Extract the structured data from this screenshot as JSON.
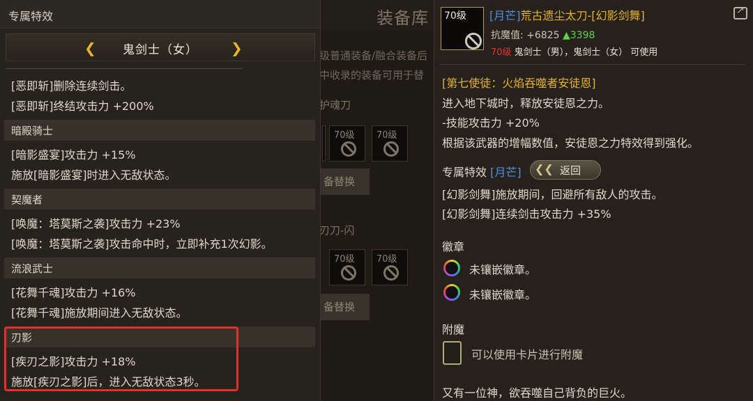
{
  "background": {
    "title": "装备库",
    "notice_lines": [
      "级普通装备/融合装备后",
      "中收录的装备可用于替"
    ],
    "section1_label": "护魂刀",
    "section2_label": "刃刀-闪",
    "slot_level": "70级",
    "swap_button": "备替换"
  },
  "left": {
    "title": "专属特效",
    "class_name": "鬼剑士（女）",
    "prev_arrow": "❮",
    "next_arrow": "❯",
    "intro_lines": [
      "[恶即斩]删除连续剑击。",
      "[恶即斩]终结攻击力 +200%"
    ],
    "sections": [
      {
        "name": "暗殿骑士",
        "lines": [
          "[暗影盛宴]攻击力 +15%",
          "施放[暗影盛宴]时进入无敌状态。"
        ]
      },
      {
        "name": "契魔者",
        "lines": [
          "[唤魔：塔莫斯之袭]攻击力 +23%",
          "[唤魔：塔莫斯之袭]攻击命中时，立即补充1次幻影。"
        ]
      },
      {
        "name": "流浪武士",
        "lines": [
          "[花舞千魂]攻击力 +16%",
          "[花舞千魂]施放期间进入无敌状态。"
        ]
      },
      {
        "name": "刃影",
        "lines": [
          "[疾刃之影]攻击力 +18%",
          "施放[疾刃之影]后，进入无敌状态3秒。"
        ]
      }
    ]
  },
  "right": {
    "item": {
      "level_badge": "70级",
      "rarity": "[月芒]",
      "name": "荒古遗尘太刀-[幻影剑舞]",
      "stat_label": "抗魔值: +6825",
      "stat_increase": "▲3398",
      "req_level": "70级",
      "req_classes": " 鬼剑士（男），鬼剑士（女） 可使用"
    },
    "apostle_title": "[第七使徒：火焰吞噬者安徒恩]",
    "apostle_lines": [
      "进入地下城时，释放安徒恩之力。",
      "-技能攻击力 +20%",
      "根据该武器的增幅数值，安徒恩之力特效得到强化。"
    ],
    "special": {
      "label": "专属特效",
      "rarity": "[月芒]",
      "back_button": "返回",
      "lines": [
        "[幻影剑舞]施放期间，回避所有敌人的攻击。",
        "[幻影剑舞]连续剑击攻击力 +35%"
      ]
    },
    "emblem": {
      "label": "徽章",
      "slots": [
        "未镶嵌徽章。",
        "未镶嵌徽章。"
      ]
    },
    "enchant": {
      "label": "附魔",
      "hint": "可以使用卡片进行附魔"
    },
    "flavor": "又有一位神，欲吞噬自己背负的巨火。"
  },
  "colors": {
    "gold": "#e5b02c",
    "rarity_blue": "#4f8ee8",
    "red": "#e03434",
    "green": "#5fd24a",
    "highlight": "#e03030"
  },
  "icons": [
    "chevron-left-icon",
    "chevron-right-icon",
    "prohibited-icon",
    "share-icon",
    "emblem-ring-icon",
    "card-slot-icon"
  ]
}
